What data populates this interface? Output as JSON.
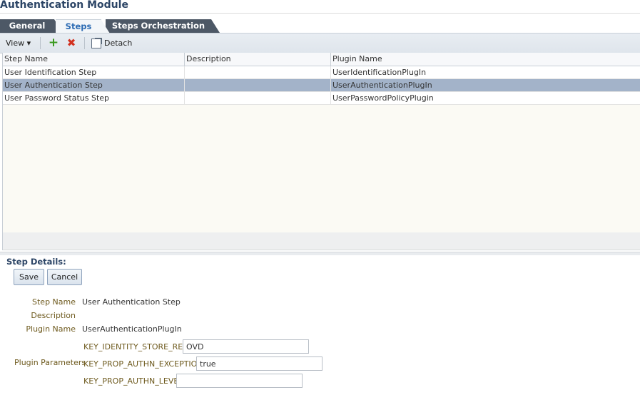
{
  "page": {
    "title": "Authentication Module"
  },
  "tabs": [
    {
      "label": "General"
    },
    {
      "label": "Steps"
    },
    {
      "label": "Steps Orchestration"
    }
  ],
  "active_tab": "Steps",
  "toolbar": {
    "view_label": "View ▾",
    "add_icon": "add-icon",
    "delete_icon": "delete-icon",
    "detach_label": "Detach",
    "colors": {
      "add": "#3a9a1e",
      "delete": "#d2301f"
    }
  },
  "table": {
    "columns": [
      "Step Name",
      "Description",
      "Plugin Name"
    ],
    "rows": [
      {
        "step_name": "User Identification Step",
        "description": "",
        "plugin_name": "UserIdentificationPlugIn",
        "selected": false
      },
      {
        "step_name": "User Authentication Step",
        "description": "",
        "plugin_name": "UserAuthenticationPlugIn",
        "selected": true
      },
      {
        "step_name": "User Password Status Step",
        "description": "",
        "plugin_name": "UserPasswordPolicyPlugin",
        "selected": false
      }
    ],
    "selected_color": "#a3b3c9"
  },
  "details": {
    "title": "Step Details:",
    "save_label": "Save",
    "cancel_label": "Cancel",
    "step_name_label": "Step Name",
    "step_name_value": "User Authentication Step",
    "description_label": "Description",
    "description_value": "",
    "plugin_name_label": "Plugin Name",
    "plugin_name_value": "UserAuthenticationPlugIn",
    "plugin_parameters_label": "Plugin Parameters",
    "params": [
      {
        "key": "KEY_IDENTITY_STORE_REF",
        "value": "OVD"
      },
      {
        "key": "KEY_PROP_AUTHN_EXCEPTION",
        "value": "true"
      },
      {
        "key": "KEY_PROP_AUTHN_LEVEL",
        "value": ""
      }
    ]
  },
  "colors": {
    "title": "#2c4566",
    "active_tab_text": "#2c6bb3",
    "inactive_tab_bg": "#4d5866",
    "label": "#6e5a1e"
  }
}
